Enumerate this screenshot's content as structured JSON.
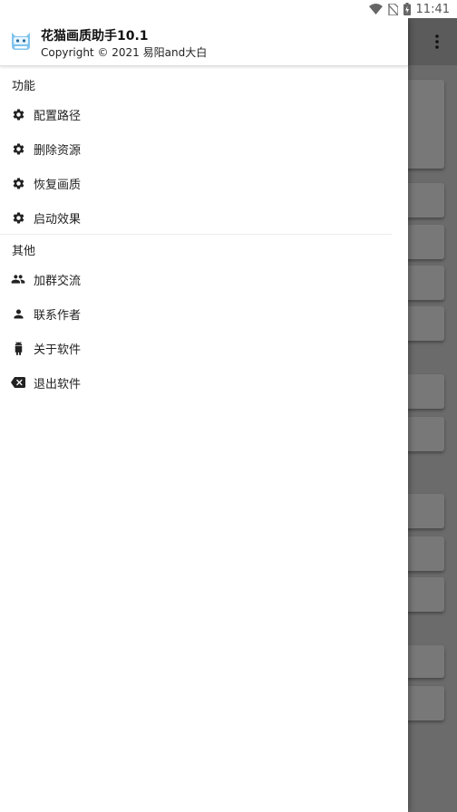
{
  "status_bar": {
    "time": "11:41"
  },
  "drawer": {
    "header": {
      "title": "花猫画质助手10.1",
      "copyright": "Copyright © 2021 易阳and大白"
    },
    "sections": [
      {
        "title": "功能",
        "items": [
          {
            "label": "配置路径",
            "icon": "gear-icon"
          },
          {
            "label": "删除资源",
            "icon": "gear-icon"
          },
          {
            "label": "恢复画质",
            "icon": "gear-icon"
          },
          {
            "label": "启动效果",
            "icon": "gear-icon"
          }
        ]
      },
      {
        "title": "其他",
        "items": [
          {
            "label": "加群交流",
            "icon": "group-icon"
          },
          {
            "label": "联系作者",
            "icon": "person-icon"
          },
          {
            "label": "关于软件",
            "icon": "android-icon"
          },
          {
            "label": "退出软件",
            "icon": "backspace-icon"
          }
        ]
      }
    ]
  },
  "colors": {
    "drawer_background": "#ffffff",
    "scrim": "#6b6b6b",
    "text_primary": "#222222",
    "icon": "#222222"
  }
}
